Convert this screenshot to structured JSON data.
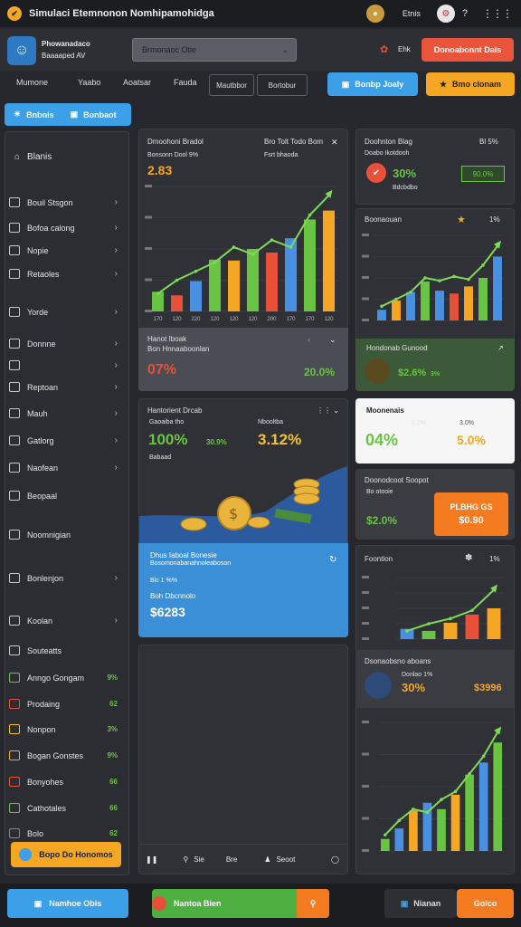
{
  "topbar": {
    "title": "Simulaci Etemnonon Nomhipamohidga",
    "user_label": "Etnis",
    "logo_glyph": "✔"
  },
  "header": {
    "brand_line1": "Phowanadaco",
    "brand_line2": "Baaaaped AV",
    "select_value": "Brmonaoc Otie",
    "pin_label": "Ehk",
    "right_button": "Donoabonnt Dais"
  },
  "nav": {
    "items": [
      "Mumone",
      "Yaabo",
      "Aoatsar",
      "Fauda"
    ],
    "boxes": [
      "Mautbbor",
      "Bortobur"
    ]
  },
  "actions": {
    "primary": "Bonbp Joaly",
    "secondary": "Bmo clonam"
  },
  "tabs": {
    "a": "Bnbnis",
    "b": "Bonbaot"
  },
  "sidebar": {
    "title": "Blanis",
    "items": [
      {
        "label": "Bouil Stsgon",
        "icon": "chart-icon"
      },
      {
        "label": "Bofoa calong",
        "icon": "wallet-icon"
      },
      {
        "label": "Nopie",
        "icon": "layers-icon"
      },
      {
        "label": "Retaoles",
        "icon": "grid-icon"
      },
      {
        "label": "Yorde",
        "icon": "folder-icon"
      },
      {
        "label": "Donnne",
        "icon": "shield-icon"
      },
      {
        "label": "",
        "icon": "card-icon"
      },
      {
        "label": "Reptoan",
        "icon": "mail-icon"
      },
      {
        "label": "Mauh",
        "icon": "clock-icon"
      },
      {
        "label": "Gatlorg",
        "icon": "database-icon"
      },
      {
        "label": "Naofean",
        "icon": "pen-icon"
      },
      {
        "label": "Beopaal",
        "icon": "image-icon"
      },
      {
        "label": "Noomnigian",
        "icon": "globe-icon"
      },
      {
        "label": "Bonlenjon",
        "icon": "trophy-icon"
      },
      {
        "label": "Koolan",
        "icon": "cart-icon"
      },
      {
        "label": "Souteatts",
        "icon": "photo-icon"
      }
    ],
    "stats": [
      {
        "label": "Anngo Gongam",
        "value": "9%"
      },
      {
        "label": "Prodaing",
        "value": "62"
      },
      {
        "label": "Nonpon",
        "value": "3%"
      },
      {
        "label": "Bogan Gonstes",
        "value": "9%"
      },
      {
        "label": "Bonyohes",
        "value": "66"
      },
      {
        "label": "Cathotales",
        "value": "66"
      },
      {
        "label": "Bolo",
        "value": "62"
      }
    ],
    "cta": "Bopo Do Honomos"
  },
  "chart1": {
    "title": "Dmoohoni Bradol",
    "subtitle": "Bro Tolt Todo Bom",
    "label": "Bonsonn Dool 9%",
    "label2": "Fsrt bhaoda",
    "value": "2.83",
    "footer_title": "Hanot Iboak",
    "footer_sub": "Bon Hnnaaboonlan",
    "left_pct": "07%",
    "right_pct": "20.0%"
  },
  "chart_data": [
    {
      "type": "bar",
      "categories": [
        "170",
        "120",
        "220",
        "120",
        "120",
        "120",
        "200",
        "170",
        "170",
        "120"
      ],
      "values": [
        22,
        18,
        34,
        58,
        57,
        70,
        66,
        82,
        103,
        113
      ],
      "colors": [
        "#6ac443",
        "#e8503a",
        "#4a90e2",
        "#6ac443",
        "#f5a623",
        "#6ac443",
        "#e8503a",
        "#4a90e2",
        "#6ac443",
        "#f5a623"
      ],
      "trend": [
        20,
        35,
        45,
        55,
        72,
        64,
        80,
        72,
        108,
        130
      ],
      "ylim": [
        0,
        140
      ]
    },
    {
      "type": "bar",
      "categories": [
        "",
        "",
        "",
        "",
        "",
        "",
        "",
        "",
        ""
      ],
      "values": [
        15,
        28,
        40,
        55,
        42,
        38,
        48,
        60,
        90
      ],
      "colors": [
        "#4a90e2",
        "#f5a623",
        "#4a90e2",
        "#6ac443",
        "#4a90e2",
        "#e8503a",
        "#f5a623",
        "#6ac443",
        "#4a90e2"
      ],
      "trend": [
        20,
        30,
        40,
        60,
        56,
        62,
        58,
        78,
        105
      ],
      "ylim": [
        0,
        120
      ]
    },
    {
      "type": "bar",
      "categories": [
        "",
        "",
        "",
        "",
        ""
      ],
      "values": [
        10,
        8,
        16,
        24,
        30
      ],
      "colors": [
        "#4a90e2",
        "#6ac443",
        "#f5a623",
        "#e8503a",
        "#f5a623"
      ],
      "trend": [
        8,
        15,
        20,
        28,
        48
      ],
      "ylim": [
        0,
        60
      ]
    },
    {
      "type": "bar",
      "categories": [
        "",
        "",
        "",
        "",
        "",
        "",
        "",
        "",
        ""
      ],
      "values": [
        15,
        28,
        50,
        60,
        52,
        70,
        95,
        110,
        135
      ],
      "colors": [
        "#6ac443",
        "#4a90e2",
        "#f5a623",
        "#4a90e2",
        "#6ac443",
        "#f5a623",
        "#6ac443",
        "#4a90e2",
        "#6ac443"
      ],
      "trend": [
        20,
        38,
        52,
        48,
        64,
        74,
        96,
        118,
        148
      ],
      "ylim": [
        0,
        160
      ]
    }
  ],
  "card2": {
    "title": "Hantorient Drcab",
    "sub": "Gaoaiba tho",
    "sub2": "Nbooltba",
    "v1": "100%",
    "v2": "3.12%",
    "v3": "30.9%",
    "tag": "Babaad"
  },
  "card3": {
    "title": "Dhus Iaboal Bonesie",
    "sub": "Bosomonabanahnoleaboson",
    "line1": "Blc 1 %%",
    "line2": "Boh Dbcnnolo",
    "value": "$6283"
  },
  "r1": {
    "title": "Doohnton Blag",
    "sub": "Doabo Ikotdooh",
    "meta": "Bl 5%",
    "value": "30%",
    "badge": "90.0%",
    "tag": "Bdcbdbo"
  },
  "r2": {
    "title": "Boonaouan",
    "pct": "1%"
  },
  "r3": {
    "title": "Hondonab Gunood",
    "v1": "$2.6%",
    "v2": "3%"
  },
  "r4": {
    "title": "Moonenais",
    "v1": "04%",
    "v2": "3.0%",
    "v3": "3.2%",
    "v4": "5.0%"
  },
  "r5": {
    "title": "Doonodcoot Soopot",
    "sub": "Bo otooie",
    "v1": "$2.0%",
    "btn_top": "PLBHG GS",
    "btn_val": "$0.90"
  },
  "r6": {
    "title": "Foontion",
    "pct": "1%"
  },
  "r7": {
    "title": "Dsonaobsno aboans",
    "sub": "Donlao 1%",
    "v1": "30%",
    "v2": "$3996"
  },
  "footer_tools": {
    "a": "Sie",
    "b": "Bre",
    "c": "Seoot"
  },
  "bottom": {
    "a": "Namhoe Obis",
    "b": "Nantoa Bien",
    "c": "Nianan",
    "d": "Golco"
  }
}
